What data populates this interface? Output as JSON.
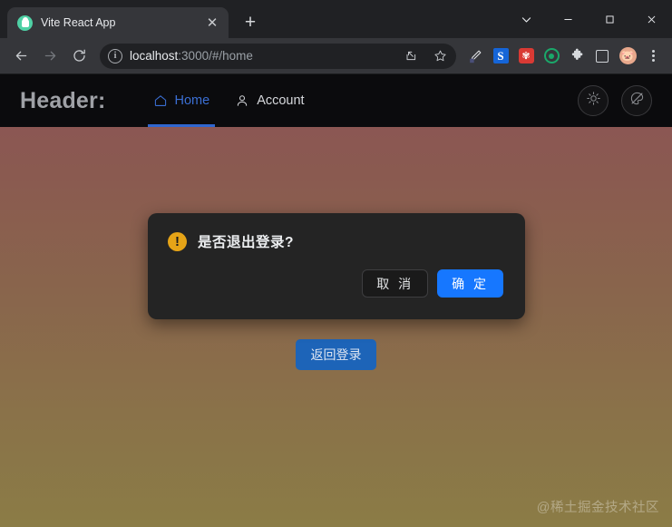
{
  "browser": {
    "tab": {
      "title": "Vite React App",
      "favicon": "vite-rabbit-icon",
      "close_label": "✕"
    },
    "new_tab_label": "+",
    "window_controls": {
      "tab_search": "⌄",
      "minimize": "—",
      "maximize": "□",
      "close": "✕"
    },
    "toolbar": {
      "back": "←",
      "forward": "→",
      "reload": "⟳",
      "site_info": "i",
      "url_host": "localhost",
      "url_rest": ":3000/#/home",
      "url_full": "localhost:3000/#/home",
      "share": "share-icon",
      "bookmark": "★",
      "extensions": [
        {
          "name": "eyedropper-extension-icon",
          "glyph": "✒"
        },
        {
          "name": "s-extension-icon",
          "glyph": "S"
        },
        {
          "name": "red-paw-extension-icon",
          "glyph": "✾"
        },
        {
          "name": "green-target-extension-icon",
          "glyph": "◎"
        },
        {
          "name": "puzzle-extensions-icon",
          "glyph": "🧩"
        },
        {
          "name": "side-panel-icon",
          "glyph": "▢"
        },
        {
          "name": "profile-avatar",
          "glyph": "🐷"
        }
      ],
      "menu": "⋮"
    }
  },
  "app": {
    "header": {
      "brand": "Header:",
      "nav": [
        {
          "label": "Home",
          "icon": "home-icon",
          "active": true
        },
        {
          "label": "Account",
          "icon": "user-icon",
          "active": false
        }
      ],
      "actions": [
        {
          "name": "theme-brightness-toggle",
          "icon": "sun-icon"
        },
        {
          "name": "color-scheme-toggle",
          "icon": "palette-slash-icon"
        }
      ],
      "accent_color": "#2f66cf",
      "background_color": "#0b0b0d"
    },
    "content": {
      "back_to_login_label": "返回登录",
      "back_to_login_color": "#1d64b8"
    },
    "modal": {
      "icon": "warning-icon",
      "icon_glyph": "!",
      "icon_color": "#e6a417",
      "title": "是否退出登录?",
      "cancel_label": "取 消",
      "confirm_label": "确 定",
      "confirm_color": "#1677ff",
      "background_color": "#242424"
    },
    "watermark": "@稀土掘金技术社区",
    "page_gradient": {
      "top": "#8d5357",
      "bottom": "#8b7c46"
    }
  }
}
